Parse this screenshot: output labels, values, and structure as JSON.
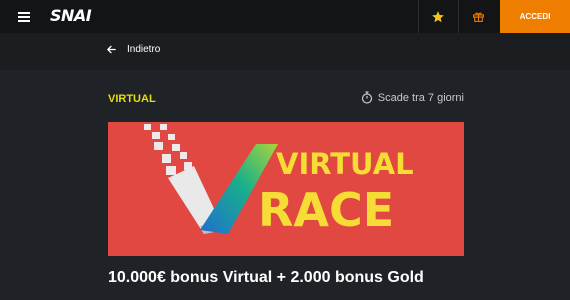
{
  "header": {
    "logo": "SNAI",
    "login_label": "ACCEDI",
    "icons": [
      "menu-icon",
      "star-icon",
      "gift-icon"
    ]
  },
  "nav": {
    "back_label": "Indietro",
    "back_icon": "arrow-left-icon"
  },
  "promo": {
    "category": "VIRTUAL",
    "expires_label": "Scade tra 7 giorni",
    "expires_icon": "stopwatch-icon",
    "banner_text_line1": "VIRTUAL",
    "banner_text_line2": "RACE",
    "title": "10.000€ bonus Virtual + 2.000 bonus Gold"
  },
  "colors": {
    "accent": "#ef7e00",
    "category": "#e6dd14",
    "banner_bg": "#e14841",
    "banner_text": "#f6dd35",
    "star": "#f5c518"
  }
}
